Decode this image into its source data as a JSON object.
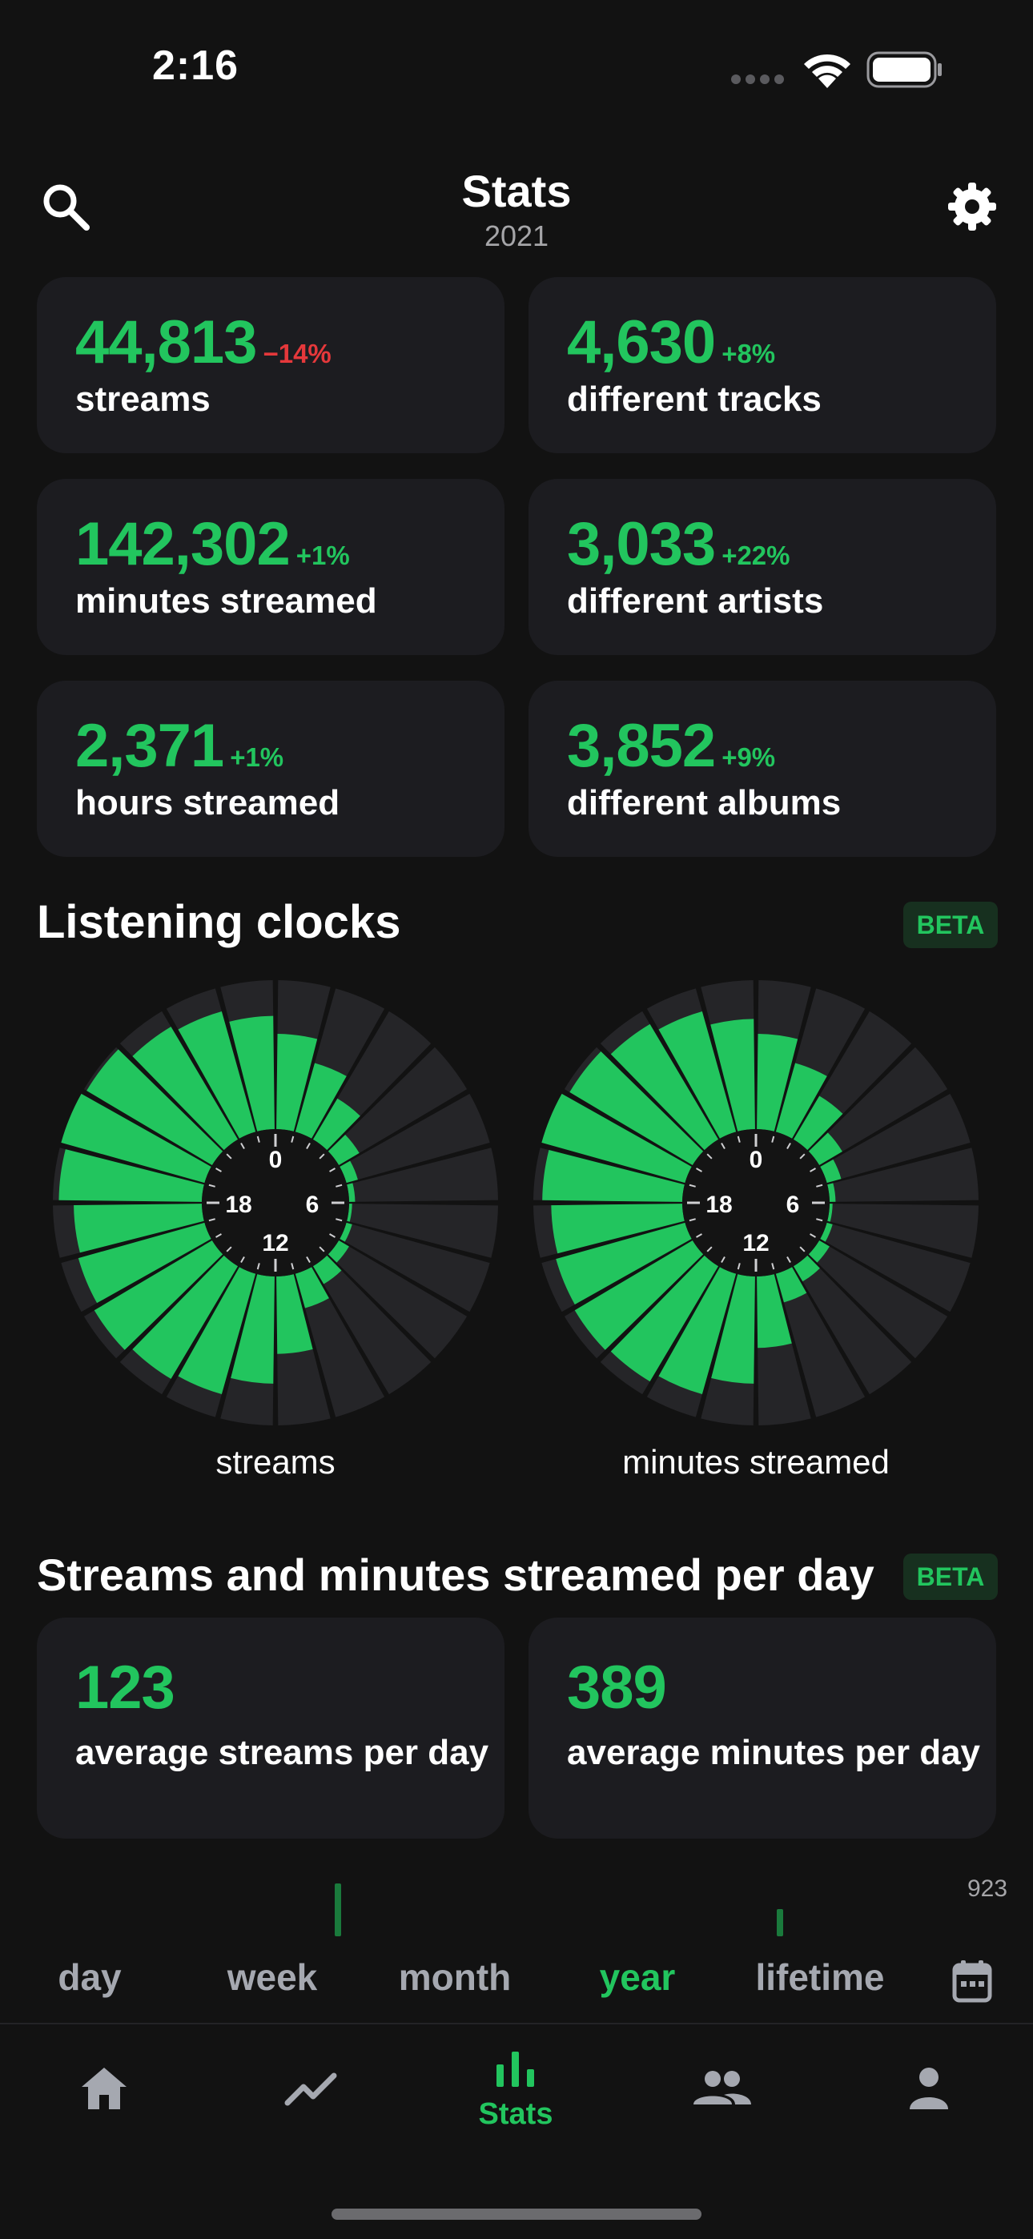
{
  "status_bar": {
    "time": "2:16"
  },
  "header": {
    "title": "Stats",
    "subtitle": "2021"
  },
  "stats": [
    {
      "value": "44,813",
      "change": "−14%",
      "label": "streams",
      "trend": "neg"
    },
    {
      "value": "4,630",
      "change": "+8%",
      "label": "different tracks",
      "trend": "pos"
    },
    {
      "value": "142,302",
      "change": "+1%",
      "label": "minutes streamed",
      "trend": "pos"
    },
    {
      "value": "3,033",
      "change": "+22%",
      "label": "different artists",
      "trend": "pos"
    },
    {
      "value": "2,371",
      "change": "+1%",
      "label": "hours streamed",
      "trend": "pos"
    },
    {
      "value": "3,852",
      "change": "+9%",
      "label": "different albums",
      "trend": "pos"
    }
  ],
  "listening_clocks": {
    "title": "Listening clocks",
    "badge": "BETA",
    "hour_labels": [
      "0",
      "6",
      "12",
      "18"
    ],
    "clocks": [
      {
        "label": "streams",
        "hourly": [
          0.64,
          0.48,
          0.32,
          0.16,
          0.08,
          0.04,
          0.02,
          0.04,
          0.08,
          0.14,
          0.24,
          0.52,
          0.72,
          0.84,
          0.88,
          0.92,
          0.88,
          0.86,
          0.96,
          1.0,
          0.98,
          0.88,
          0.84,
          0.76
        ]
      },
      {
        "label": "minutes streamed",
        "hourly": [
          0.64,
          0.48,
          0.34,
          0.18,
          0.1,
          0.04,
          0.02,
          0.04,
          0.08,
          0.12,
          0.2,
          0.48,
          0.72,
          0.84,
          0.9,
          0.92,
          0.9,
          0.88,
          0.94,
          1.0,
          0.96,
          0.9,
          0.84,
          0.74
        ]
      }
    ],
    "colors": {
      "accent": "#22c55e",
      "track": "#252528",
      "center": "#141414"
    }
  },
  "per_day": {
    "title": "Streams and minutes streamed per day",
    "badge": "BETA",
    "averages": [
      {
        "value": "123",
        "label": "average streams per day"
      },
      {
        "value": "389",
        "label": "average minutes per day"
      }
    ],
    "chart_max": "923"
  },
  "periods": {
    "items": [
      "day",
      "week",
      "month",
      "year",
      "lifetime"
    ],
    "active": "year"
  },
  "nav": {
    "active_label": "Stats"
  }
}
